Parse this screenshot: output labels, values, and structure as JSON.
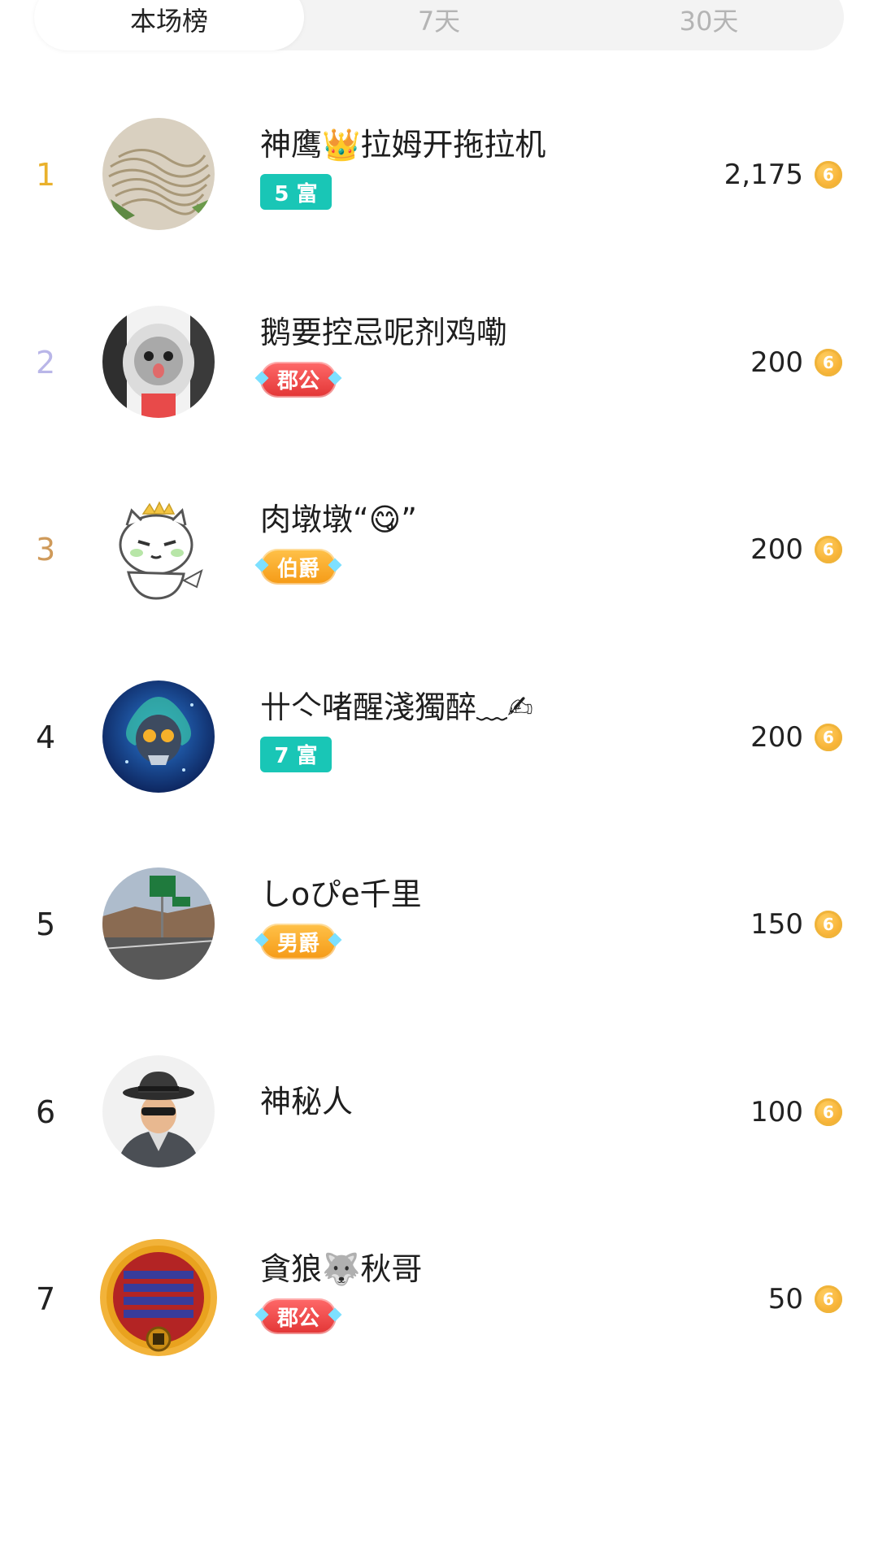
{
  "tabs": [
    {
      "label": "本场榜",
      "active": true
    },
    {
      "label": "7天",
      "active": false
    },
    {
      "label": "30天",
      "active": false
    }
  ],
  "colors": {
    "rank1": "#e9b12c",
    "rank2": "#b9b6e8",
    "rank3": "#cf9a5a",
    "rank_default": "#222222",
    "teal_badge": "#19c6b6",
    "red_badge": "#e23535",
    "orange_badge": "#f59a16",
    "coin": "#f3a11b"
  },
  "coin_icon": "coin-icon",
  "coin_glyph": "6",
  "rows": [
    {
      "rank": "1",
      "name": "神鹰👑拉姆开拖拉机",
      "badge": "5 富",
      "badge_style": "teal",
      "score": "2,175",
      "avatar": "noodles-avatar"
    },
    {
      "rank": "2",
      "name": "鹅要控忌呢剂鸡嘞",
      "badge": "郡公",
      "badge_style": "red",
      "score": "200",
      "avatar": "cat-hoodie-avatar"
    },
    {
      "rank": "3",
      "name": "肉墩墩“😋”",
      "badge": "伯爵",
      "badge_style": "orange",
      "score": "200",
      "avatar": "cartoon-cat-avatar"
    },
    {
      "rank": "4",
      "name": "卄亽啫醒淺獨醉﹏✍",
      "badge": "7 富",
      "badge_style": "teal",
      "score": "200",
      "avatar": "skull-avatar"
    },
    {
      "rank": "5",
      "name": "しoぴe千里",
      "badge": "男爵",
      "badge_style": "orange",
      "score": "150",
      "avatar": "highway-avatar"
    },
    {
      "rank": "6",
      "name": "神秘人",
      "badge": "",
      "badge_style": "none",
      "score": "100",
      "avatar": "mystery-man-avatar"
    },
    {
      "rank": "7",
      "name": "貪狼🐺秋哥",
      "badge": "郡公",
      "badge_style": "red",
      "score": "50",
      "avatar": "framed-avatar"
    }
  ]
}
